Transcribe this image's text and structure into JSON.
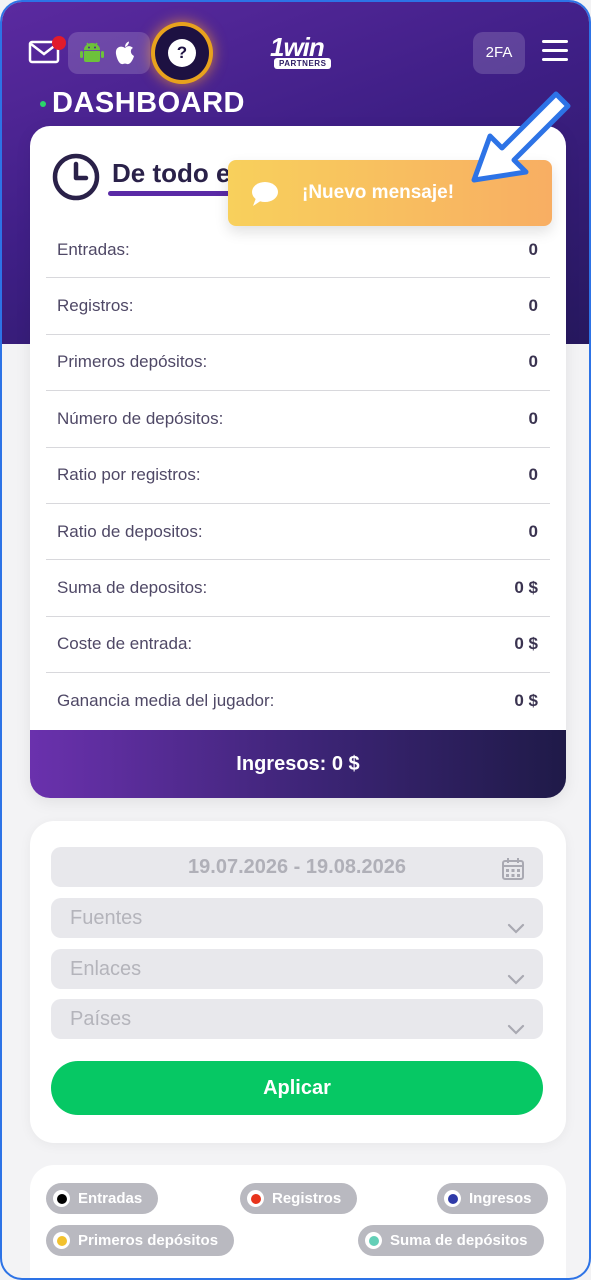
{
  "header": {
    "twofa_label": "2FA",
    "logo_main": "1win",
    "logo_sub": "PARTNERS",
    "help_label": "?"
  },
  "page_title": "DASHBOARD",
  "stats": {
    "period_title": "De todo e",
    "rows": [
      {
        "label": "Entradas:",
        "value": "0"
      },
      {
        "label": "Registros:",
        "value": "0"
      },
      {
        "label": "Primeros depósitos:",
        "value": "0"
      },
      {
        "label": "Número de depósitos:",
        "value": "0"
      },
      {
        "label": "Ratio por registros:",
        "value": "0"
      },
      {
        "label": "Ratio de depositos:",
        "value": "0"
      },
      {
        "label": "Suma de depositos:",
        "value": "0 $"
      },
      {
        "label": "Coste de entrada:",
        "value": "0 $"
      },
      {
        "label": "Ganancia media del jugador:",
        "value": "0 $"
      }
    ],
    "revenue_label": "Ingresos: 0 $"
  },
  "toast": {
    "message": "¡Nuevo mensaje!"
  },
  "filters": {
    "date_range": "19.07.2026 - 19.08.2026",
    "sources_placeholder": "Fuentes",
    "links_placeholder": "Enlaces",
    "countries_placeholder": "Países",
    "apply_label": "Aplicar"
  },
  "legend": {
    "items": [
      {
        "label": "Entradas",
        "color": "#000000"
      },
      {
        "label": "Registros",
        "color": "#e8341c"
      },
      {
        "label": "Ingresos",
        "color": "#2f3aa8"
      },
      {
        "label": "Primeros depósitos",
        "color": "#f2c12e"
      },
      {
        "label": "Suma de depósitos",
        "color": "#63cfb7"
      }
    ]
  },
  "colors": {
    "accent_purple": "#5b2aa0",
    "apply_green": "#06c864",
    "notification_red": "#e21b2b"
  }
}
